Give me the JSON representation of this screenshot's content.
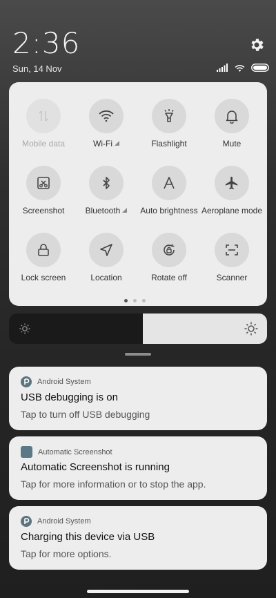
{
  "status": {
    "time": "2:36",
    "date": "Sun, 14 Nov"
  },
  "tiles": [
    {
      "label": "Mobile data",
      "icon": "mobile-data-icon",
      "active": false
    },
    {
      "label": "Wi-Fi",
      "icon": "wifi-icon",
      "active": true
    },
    {
      "label": "Flashlight",
      "icon": "flashlight-icon",
      "active": true
    },
    {
      "label": "Mute",
      "icon": "bell-icon",
      "active": true
    },
    {
      "label": "Screenshot",
      "icon": "screenshot-icon",
      "active": true
    },
    {
      "label": "Bluetooth",
      "icon": "bluetooth-icon",
      "active": true
    },
    {
      "label": "Auto brightness",
      "icon": "auto-brightness-icon",
      "active": true
    },
    {
      "label": "Aeroplane mode",
      "icon": "airplane-icon",
      "active": true
    },
    {
      "label": "Lock screen",
      "icon": "lock-icon",
      "active": true
    },
    {
      "label": "Location",
      "icon": "location-icon",
      "active": true
    },
    {
      "label": "Rotate off",
      "icon": "rotate-icon",
      "active": true
    },
    {
      "label": "Scanner",
      "icon": "scanner-icon",
      "active": true
    }
  ],
  "pager": {
    "pages": 3,
    "current": 1
  },
  "brightness": {
    "level": 0.48
  },
  "notifications": [
    {
      "app": "Android System",
      "title": "USB debugging is on",
      "body": "Tap to turn off USB debugging"
    },
    {
      "app": "Automatic Screenshot",
      "title": "Automatic Screenshot is running",
      "body": "Tap for more information or to stop the app."
    },
    {
      "app": "Android System",
      "title": "Charging this device via USB",
      "body": "Tap for more options."
    }
  ],
  "colors": {
    "panel": "#ededed",
    "tile_circle": "#d9d9d9",
    "app_icon": "#5e7380"
  }
}
